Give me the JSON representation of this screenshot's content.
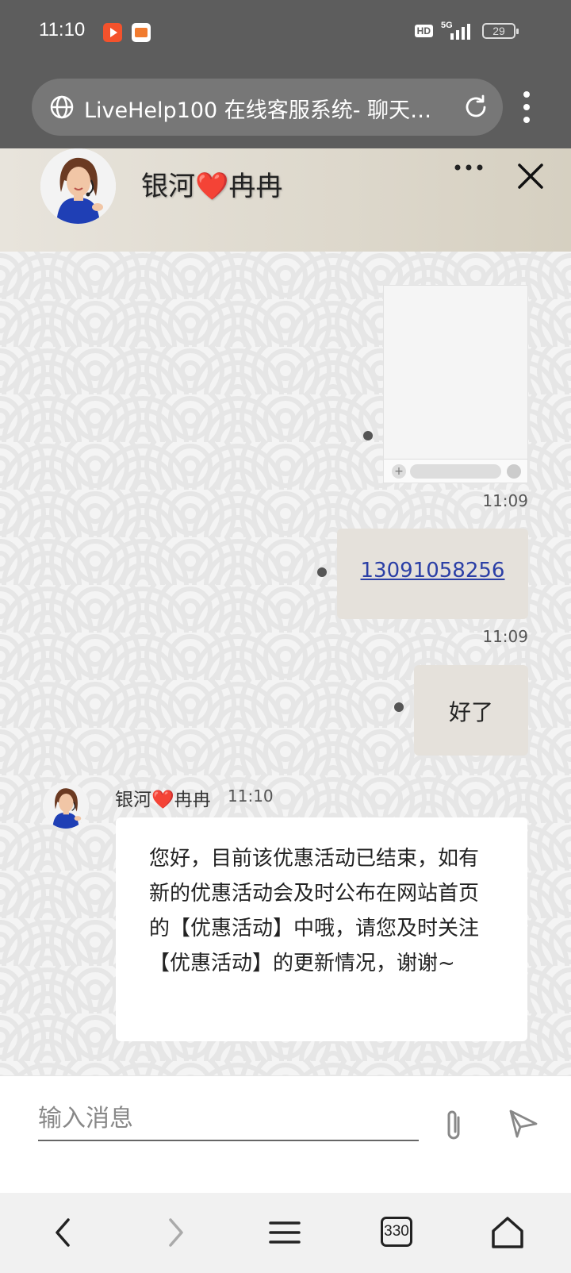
{
  "status_bar": {
    "time": "11:10",
    "network": "5G",
    "hd": "HD",
    "battery": "29"
  },
  "browser": {
    "url_title": "LiveHelp100 在线客服系统- 聊天…",
    "globe_icon": "globe-icon",
    "reload_icon": "reload-icon",
    "menu_icon": "kebab-menu-icon"
  },
  "chat_header": {
    "agent_name": "银河❤️冉冉"
  },
  "messages": {
    "image_message": {
      "mini_input_text": "​"
    },
    "phone_message": {
      "time": "11:09",
      "text": "13091058256"
    },
    "ok_message": {
      "time": "11:09",
      "text": "好了"
    },
    "agent_message": {
      "name": "银河❤️冉冉",
      "time": "11:10",
      "text": "您好，目前该优惠活动已结束，如有新的优惠活动会及时公布在网站首页的【优惠活动】中哦，请您及时关注【优惠活动】的更新情况，谢谢~"
    }
  },
  "input_bar": {
    "placeholder": "输入消息"
  },
  "bottom_nav": {
    "tabs_count": "330"
  },
  "colors": {
    "chrome": "#5d5d5d",
    "link": "#2b3fa6",
    "outgoing_bubble": "#e5e1db",
    "incoming_bubble": "#ffffff"
  }
}
